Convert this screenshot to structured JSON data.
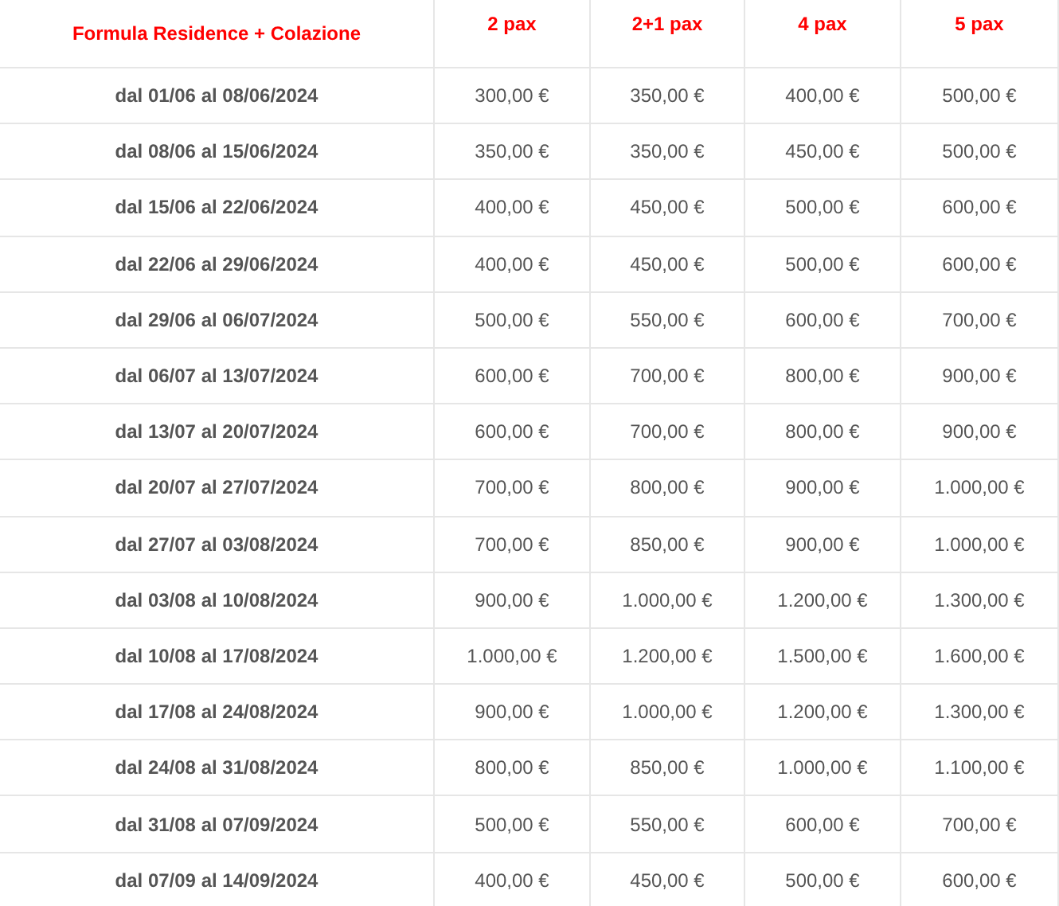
{
  "table": {
    "columns": [
      "Formula Residence + Colazione",
      "2 pax",
      "2+1 pax",
      "4 pax",
      "5 pax"
    ],
    "rows": [
      [
        "dal 01/06 al 08/06/2024",
        "300,00 €",
        "350,00 €",
        "400,00 €",
        "500,00 €"
      ],
      [
        "dal 08/06 al 15/06/2024",
        "350,00 €",
        "350,00 €",
        "450,00 €",
        "500,00 €"
      ],
      [
        "dal 15/06 al 22/06/2024",
        "400,00 €",
        "450,00 €",
        "500,00 €",
        "600,00 €"
      ],
      [
        "dal 22/06 al 29/06/2024",
        "400,00 €",
        "450,00 €",
        "500,00 €",
        "600,00 €"
      ],
      [
        "dal 29/06 al 06/07/2024",
        "500,00 €",
        "550,00 €",
        "600,00 €",
        "700,00 €"
      ],
      [
        "dal 06/07 al 13/07/2024",
        "600,00 €",
        "700,00 €",
        "800,00 €",
        "900,00 €"
      ],
      [
        "dal 13/07 al 20/07/2024",
        "600,00 €",
        "700,00 €",
        "800,00 €",
        "900,00 €"
      ],
      [
        "dal 20/07 al 27/07/2024",
        "700,00 €",
        "800,00 €",
        "900,00 €",
        "1.000,00 €"
      ],
      [
        "dal 27/07 al 03/08/2024",
        "700,00 €",
        "850,00 €",
        "900,00 €",
        "1.000,00 €"
      ],
      [
        "dal 03/08 al 10/08/2024",
        "900,00 €",
        "1.000,00 €",
        "1.200,00 €",
        "1.300,00 €"
      ],
      [
        "dal 10/08 al 17/08/2024",
        "1.000,00 €",
        "1.200,00 €",
        "1.500,00 €",
        "1.600,00 €"
      ],
      [
        "dal 17/08 al 24/08/2024",
        "900,00 €",
        "1.000,00 €",
        "1.200,00 €",
        "1.300,00 €"
      ],
      [
        "dal 24/08 al 31/08/2024",
        "800,00 €",
        "850,00 €",
        "1.000,00 €",
        "1.100,00 €"
      ],
      [
        "dal 31/08 al 07/09/2024",
        "500,00 €",
        "550,00 €",
        "600,00 €",
        "700,00 €"
      ],
      [
        "dal 07/09 al 14/09/2024",
        "400,00 €",
        "450,00 €",
        "500,00 €",
        "600,00 €"
      ]
    ]
  }
}
